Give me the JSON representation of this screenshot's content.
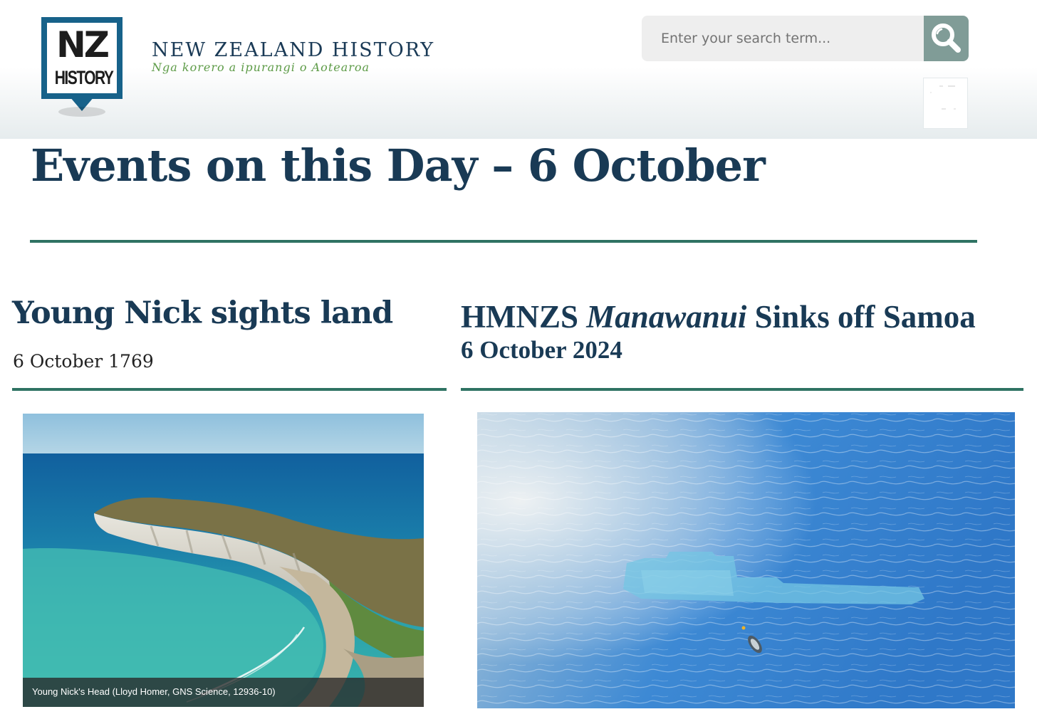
{
  "header": {
    "logo_top": "NZ",
    "logo_bottom": "HISTORY",
    "site_title": "NEW ZEALAND HISTORY",
    "site_subtitle": "Nga korero a ipurangi o Aotearoa",
    "search_placeholder": "Enter your search term...",
    "search_icon": "search-icon"
  },
  "page_title": "Events on this Day – 6 October",
  "events": [
    {
      "title": "Young Nick sights land",
      "date": "6 October 1769",
      "image_caption": "Young Nick's Head (Lloyd Homer, GNS Science, 12936-10)"
    },
    {
      "title_prefix": "HMNZS ",
      "title_ship": "Manawanui",
      "title_suffix": " Sinks off Samoa",
      "date": "6 October 2024"
    }
  ],
  "colors": {
    "navy": "#193a55",
    "rule_green": "#2f7363",
    "subtitle_green": "#5d9b47",
    "logo_blue": "#17628a",
    "search_button": "#809c97"
  }
}
